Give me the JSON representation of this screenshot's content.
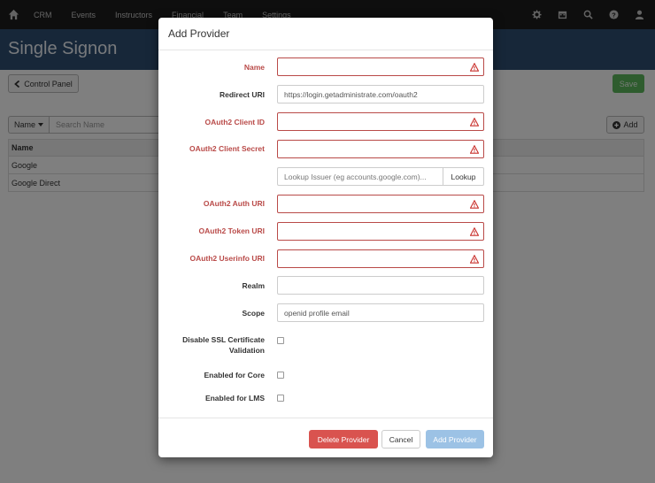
{
  "navbar": {
    "links": [
      "CRM",
      "Events",
      "Instructors",
      "Financial",
      "Team",
      "Settings"
    ]
  },
  "page": {
    "title": "Single Signon",
    "control_panel_label": "Control Panel",
    "save_label": "Save",
    "filter_label": "Name",
    "search_placeholder": "Search Name",
    "add_label": "Add",
    "table": {
      "header": "Name",
      "rows": [
        "Google",
        "Google Direct"
      ]
    }
  },
  "modal": {
    "title": "Add Provider",
    "fields": {
      "name": {
        "label": "Name",
        "value": ""
      },
      "redirect_uri": {
        "label": "Redirect URI",
        "value": "https://login.getadministrate.com/oauth2"
      },
      "client_id": {
        "label": "OAuth2 Client ID",
        "value": ""
      },
      "client_secret": {
        "label": "OAuth2 Client Secret",
        "value": ""
      },
      "lookup": {
        "placeholder": "Lookup Issuer (eg accounts.google.com)...",
        "button": "Lookup"
      },
      "auth_uri": {
        "label": "OAuth2 Auth URI",
        "value": ""
      },
      "token_uri": {
        "label": "OAuth2 Token URI",
        "value": ""
      },
      "userinfo_uri": {
        "label": "OAuth2 Userinfo URI",
        "value": ""
      },
      "realm": {
        "label": "Realm",
        "value": ""
      },
      "scope": {
        "label": "Scope",
        "value": "openid profile email"
      },
      "disable_ssl": {
        "label_line1": "Disable SSL Certificate",
        "label_line2": "Validation",
        "checked": false
      },
      "enabled_core": {
        "label": "Enabled for Core",
        "checked": false
      },
      "enabled_lms": {
        "label": "Enabled for LMS",
        "checked": false
      }
    },
    "footer": {
      "delete_label": "Delete Provider",
      "cancel_label": "Cancel",
      "add_label": "Add Provider"
    }
  },
  "colors": {
    "navbar": "#1d1d1d",
    "header_band": "#2e4e73",
    "error": "#b94a48",
    "danger": "#d9534f",
    "primary_disabled": "#9cc2e5",
    "success": "#5cb85c"
  }
}
